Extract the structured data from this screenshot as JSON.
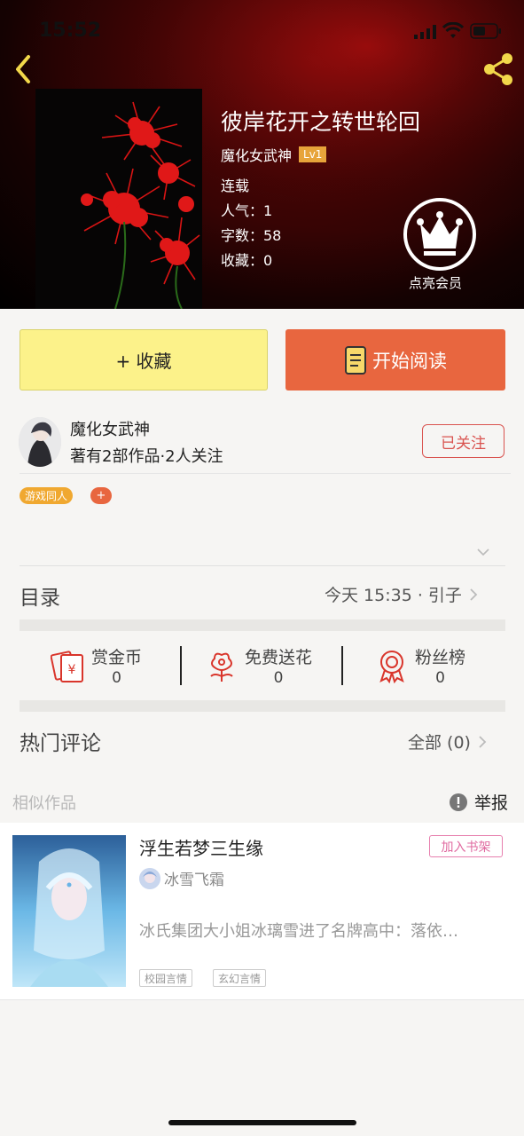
{
  "status_bar": {
    "time": "15:52"
  },
  "book": {
    "title": "彼岸花开之转世轮回",
    "author": "魔化女武神",
    "level": "Lv1",
    "status": "连载",
    "popularity": "人气：1",
    "word_count": "字数：58",
    "favorites": "收藏：0"
  },
  "vip": {
    "label": "点亮会员"
  },
  "actions": {
    "favorite_label": "+ 收藏",
    "read_label": "开始阅读"
  },
  "author_card": {
    "name": "魔化女武神",
    "stats": "著有2部作品·2人关注",
    "follow_label": "已关注"
  },
  "tags": {
    "primary": "游戏同人",
    "add": "+"
  },
  "toc": {
    "label": "目录",
    "latest": "今天 15:35 · 引子"
  },
  "stats": [
    {
      "label": "赏金币",
      "value": "0",
      "icon": "coin-icon"
    },
    {
      "label": "免费送花",
      "value": "0",
      "icon": "flower-icon"
    },
    {
      "label": "粉丝榜",
      "value": "0",
      "icon": "medal-icon"
    }
  ],
  "comments": {
    "label": "热门评论",
    "all_label": "全部 (0)"
  },
  "similar": {
    "label": "相似作品",
    "report_label": "举报",
    "items": [
      {
        "title": "浮生若梦三生缘",
        "add_label": "加入书架",
        "author": "冰雪飞霜",
        "description": "冰氏集团大小姐冰璃雪进了名牌高中：落依…",
        "tags": [
          "校园言情",
          "玄幻言情"
        ]
      }
    ]
  },
  "colors": {
    "accent": "#e8663f",
    "favorite_bg": "#fcf28a",
    "follow": "#d9534f",
    "tag": "#f0a830",
    "pink": "#e06aa0"
  }
}
